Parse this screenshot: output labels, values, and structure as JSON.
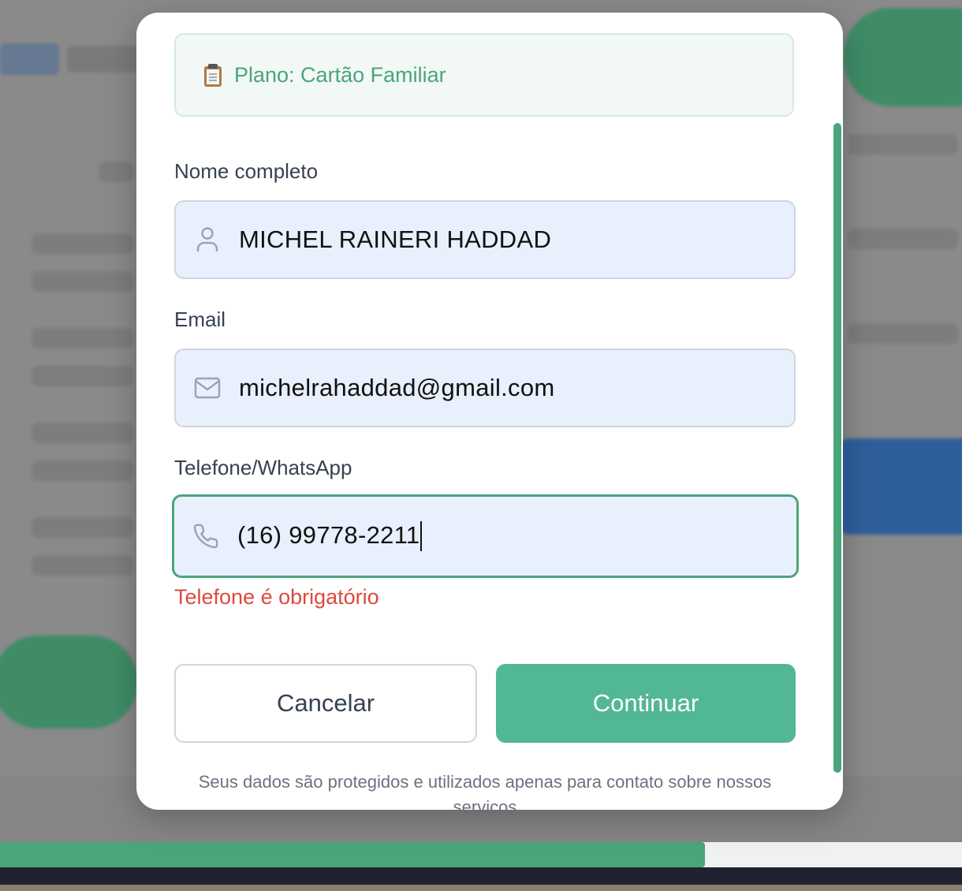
{
  "plan": {
    "icon": "clipboard-icon",
    "text": "Plano: Cartão Familiar"
  },
  "form": {
    "name": {
      "label": "Nome completo",
      "icon": "user-icon",
      "value": "MICHEL RAINERI HADDAD"
    },
    "email": {
      "label": "Email",
      "icon": "mail-icon",
      "value": "michelrahaddad@gmail.com"
    },
    "phone": {
      "label": "Telefone/WhatsApp",
      "icon": "phone-icon",
      "value": "(16) 99778-2211",
      "error": "Telefone é obrigatório"
    }
  },
  "buttons": {
    "cancel": "Cancelar",
    "continue": "Continuar"
  },
  "privacy_note": "Seus dados são protegidos e utilizados apenas para contato sobre nossos serviços",
  "progress": {
    "fraction": 0.733
  },
  "colors": {
    "accent": "#52b795",
    "accent_dark": "#4aa57b",
    "error": "#dc4a3c",
    "input_bg": "#e8effd"
  }
}
